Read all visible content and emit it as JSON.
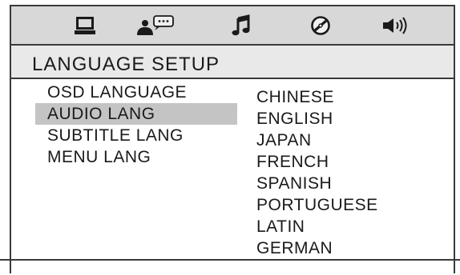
{
  "header": {
    "tabs": [
      {
        "icon": "monitor-icon"
      },
      {
        "icon": "speech-bubble-person-icon"
      },
      {
        "icon": "music-note-icon"
      },
      {
        "icon": "disc-icon"
      },
      {
        "icon": "speaker-icon"
      }
    ]
  },
  "page": {
    "title": "LANGUAGE SETUP"
  },
  "menu": {
    "items": [
      {
        "label": "OSD LANGUAGE"
      },
      {
        "label": "AUDIO LANG"
      },
      {
        "label": "SUBTITLE LANG"
      },
      {
        "label": "MENU LANG"
      }
    ],
    "selected": "AUDIO LANG"
  },
  "options": {
    "items": [
      {
        "label": "CHINESE"
      },
      {
        "label": "ENGLISH"
      },
      {
        "label": "JAPAN"
      },
      {
        "label": "FRENCH"
      },
      {
        "label": "SPANISH"
      },
      {
        "label": "PORTUGUESE"
      },
      {
        "label": "LATIN"
      },
      {
        "label": "GERMAN"
      }
    ]
  },
  "colors": {
    "icon_bar": "#d8d8d8",
    "title_band": "#e9e9e9",
    "selected_row": "#c4c4c4",
    "text": "#1a1a1a"
  }
}
